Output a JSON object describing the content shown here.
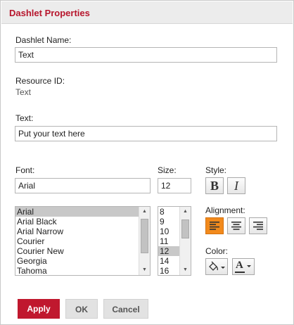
{
  "dialog": {
    "title": "Dashlet Properties"
  },
  "dashlet_name": {
    "label": "Dashlet Name:",
    "value": "Text"
  },
  "resource_id": {
    "label": "Resource ID:",
    "value": "Text"
  },
  "text": {
    "label": "Text:",
    "value": "Put your text here"
  },
  "font": {
    "label": "Font:",
    "value": "Arial",
    "options": [
      "Arial",
      "Arial Black",
      "Arial Narrow",
      "Courier",
      "Courier New",
      "Georgia",
      "Tahoma"
    ],
    "selected": "Arial"
  },
  "size": {
    "label": "Size:",
    "value": "12",
    "options": [
      "8",
      "9",
      "10",
      "11",
      "12",
      "14",
      "16"
    ],
    "selected": "12"
  },
  "style": {
    "label": "Style:",
    "bold_glyph": "B",
    "italic_glyph": "I"
  },
  "alignment": {
    "label": "Alignment:",
    "selected": "left"
  },
  "color": {
    "label": "Color:",
    "text_glyph": "A",
    "accent": "#f28a1c"
  },
  "footer": {
    "apply_label": "Apply",
    "ok_label": "OK",
    "cancel_label": "Cancel"
  }
}
